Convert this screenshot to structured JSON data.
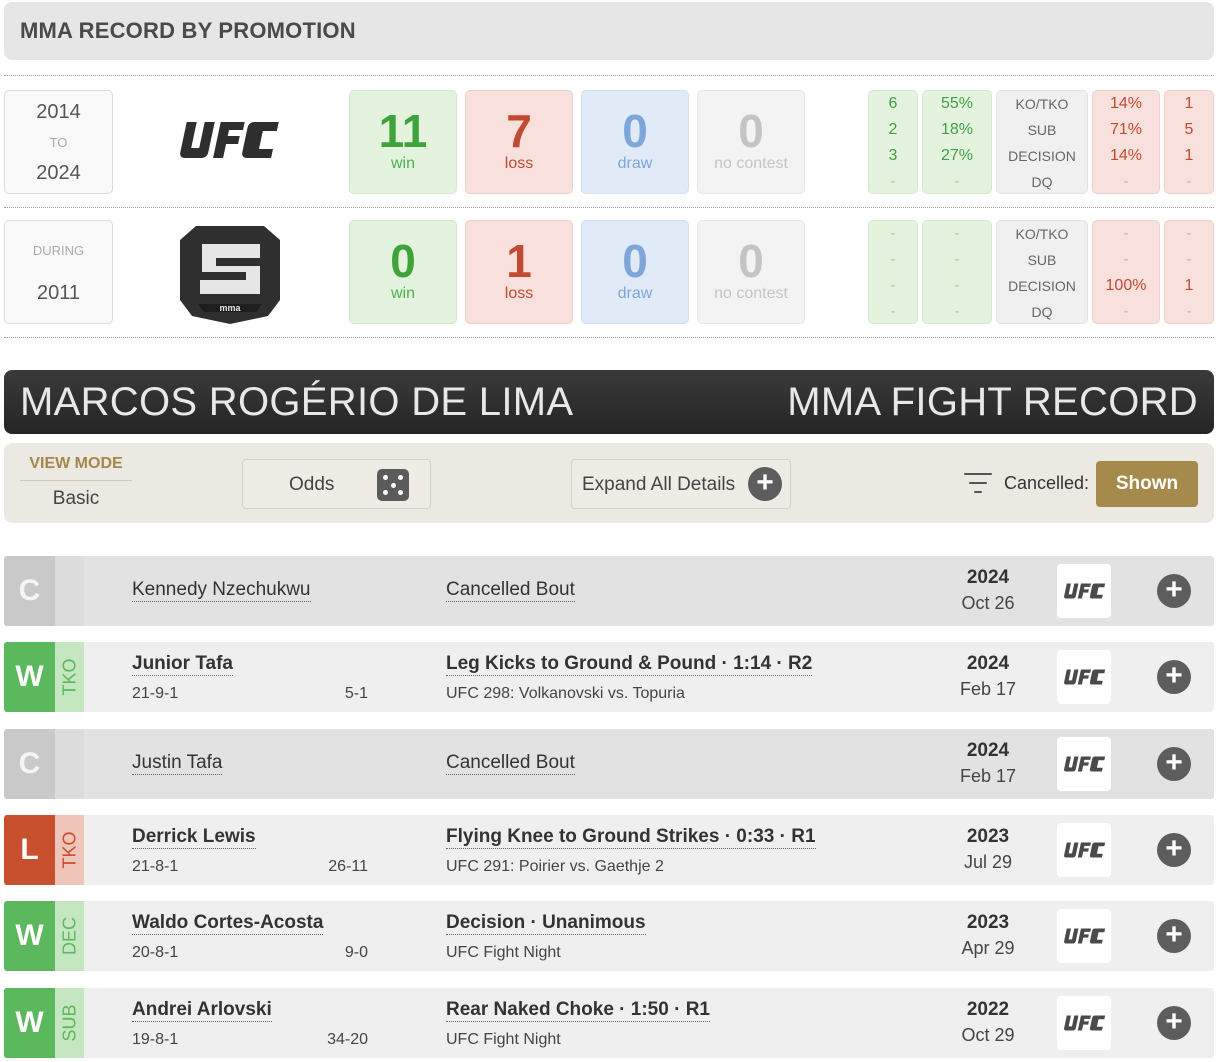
{
  "promotion_section": {
    "title": "MMA RECORD BY PROMOTION",
    "rows": [
      {
        "years_top": "2014",
        "years_mid": "TO",
        "years_bottom": "2024",
        "logo": "ufc-logo",
        "win": "11",
        "win_label": "win",
        "loss": "7",
        "loss_label": "loss",
        "draw": "0",
        "draw_label": "draw",
        "nc": "0",
        "nc_label": "no contest",
        "win_counts": [
          "6",
          "2",
          "3",
          "-"
        ],
        "win_pcts": [
          "55%",
          "18%",
          "27%",
          "-"
        ],
        "methods": [
          "KO/TKO",
          "SUB",
          "DECISION",
          "DQ"
        ],
        "loss_pcts": [
          "14%",
          "71%",
          "14%",
          "-"
        ],
        "loss_counts": [
          "1",
          "5",
          "1",
          "-"
        ]
      },
      {
        "years_top": "DURING",
        "years_bottom": "2011",
        "logo": "shine-fights-logo",
        "win": "0",
        "win_label": "win",
        "loss": "1",
        "loss_label": "loss",
        "draw": "0",
        "draw_label": "draw",
        "nc": "0",
        "nc_label": "no contest",
        "win_counts": [
          "-",
          "-",
          "-",
          "-"
        ],
        "win_pcts": [
          "-",
          "-",
          "-",
          "-"
        ],
        "methods": [
          "KO/TKO",
          "SUB",
          "DECISION",
          "DQ"
        ],
        "loss_pcts": [
          "-",
          "-",
          "100%",
          "-"
        ],
        "loss_counts": [
          "-",
          "-",
          "1",
          "-"
        ]
      }
    ],
    "s_logo_text": "mma"
  },
  "banner": {
    "fighter_name": "MARCOS ROGÉRIO DE LIMA",
    "right_title": "MMA FIGHT RECORD"
  },
  "controls": {
    "view_mode_label": "VIEW MODE",
    "view_mode_value": "Basic",
    "odds_label": "Odds",
    "expand_label": "Expand All Details",
    "cancelled_label": "Cancelled:",
    "shown_label": "Shown"
  },
  "fights": [
    {
      "result": "C",
      "method_short": "",
      "opponent": "Kennedy Nzechukwu",
      "opp_record": "",
      "opp_record_vs": "",
      "method": "Cancelled Bout",
      "event": "",
      "year": "2024",
      "date": "Oct 26",
      "promotion": "UFC"
    },
    {
      "result": "W",
      "method_short": "TKO",
      "opponent": "Junior Tafa",
      "opp_record": "21-9-1",
      "opp_record_vs": "5-1",
      "method": "Leg Kicks to Ground & Pound · 1:14 · R2",
      "event": "UFC 298: Volkanovski vs. Topuria",
      "year": "2024",
      "date": "Feb 17",
      "promotion": "UFC"
    },
    {
      "result": "C",
      "method_short": "",
      "opponent": "Justin Tafa",
      "opp_record": "",
      "opp_record_vs": "",
      "method": "Cancelled Bout",
      "event": "",
      "year": "2024",
      "date": "Feb 17",
      "promotion": "UFC"
    },
    {
      "result": "L",
      "method_short": "TKO",
      "opponent": "Derrick Lewis",
      "opp_record": "21-8-1",
      "opp_record_vs": "26-11",
      "method": "Flying Knee to Ground Strikes · 0:33 · R1",
      "event": "UFC 291: Poirier vs. Gaethje 2",
      "year": "2023",
      "date": "Jul 29",
      "promotion": "UFC"
    },
    {
      "result": "W",
      "method_short": "DEC",
      "opponent": "Waldo Cortes-Acosta",
      "opp_record": "20-8-1",
      "opp_record_vs": "9-0",
      "method": "Decision · Unanimous",
      "event": "UFC Fight Night",
      "year": "2023",
      "date": "Apr 29",
      "promotion": "UFC"
    },
    {
      "result": "W",
      "method_short": "SUB",
      "opponent": "Andrei Arlovski",
      "opp_record": "19-8-1",
      "opp_record_vs": "34-20",
      "method": "Rear Naked Choke · 1:50 · R1",
      "event": "UFC Fight Night",
      "year": "2022",
      "date": "Oct 29",
      "promotion": "UFC"
    }
  ],
  "colors": {
    "win": "#5cb85c",
    "loss": "#c9502f",
    "draw": "#7fa6d8",
    "cancelled": "#c9c9c9",
    "accent_gold": "#a58a4c",
    "banner_bg": "#2e2e2e"
  }
}
